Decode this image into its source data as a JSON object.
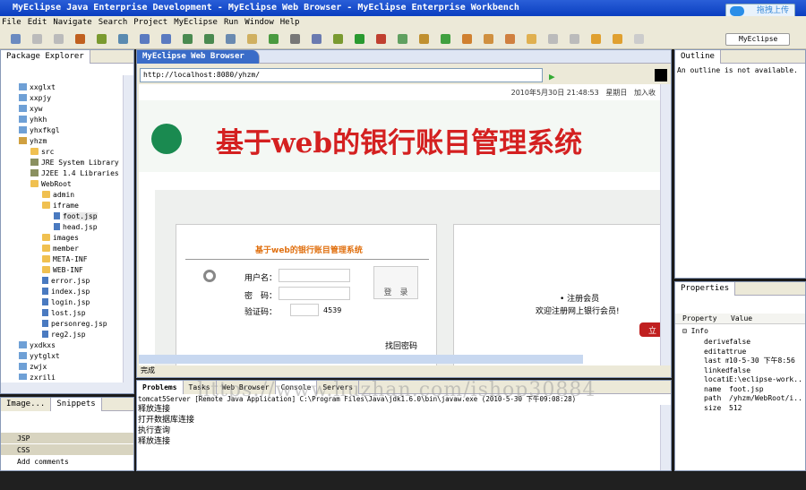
{
  "window": {
    "title": "MyEclipse Java Enterprise Development - MyEclipse Web Browser - MyEclipse Enterprise Workbench",
    "upload_label": "拖拽上传"
  },
  "menu": [
    "File",
    "Edit",
    "Navigate",
    "Search",
    "Project",
    "MyEclipse",
    "Run",
    "Window",
    "Help"
  ],
  "perspective": "MyEclipse ...",
  "package_explorer": {
    "title": "Package Explorer",
    "tree": [
      {
        "label": "xxglxt",
        "depth": 0,
        "type": "fold"
      },
      {
        "label": "xxpjy",
        "depth": 0,
        "type": "fold"
      },
      {
        "label": "xyw",
        "depth": 0,
        "type": "fold"
      },
      {
        "label": "yhkh",
        "depth": 0,
        "type": "fold"
      },
      {
        "label": "yhxfkgl",
        "depth": 0,
        "type": "fold"
      },
      {
        "label": "yhzm",
        "depth": 0,
        "type": "proj"
      },
      {
        "label": "src",
        "depth": 1,
        "type": "ofold"
      },
      {
        "label": "JRE System Library [W",
        "depth": 1,
        "type": "lib"
      },
      {
        "label": "J2EE 1.4 Libraries",
        "depth": 1,
        "type": "lib"
      },
      {
        "label": "WebRoot",
        "depth": 1,
        "type": "ofold"
      },
      {
        "label": "admin",
        "depth": 2,
        "type": "ofold"
      },
      {
        "label": "iframe",
        "depth": 2,
        "type": "ofold"
      },
      {
        "label": "foot.jsp",
        "depth": 3,
        "type": "jsp"
      },
      {
        "label": "head.jsp",
        "depth": 3,
        "type": "jsp"
      },
      {
        "label": "images",
        "depth": 2,
        "type": "ofold"
      },
      {
        "label": "member",
        "depth": 2,
        "type": "ofold"
      },
      {
        "label": "META-INF",
        "depth": 2,
        "type": "ofold"
      },
      {
        "label": "WEB-INF",
        "depth": 2,
        "type": "ofold"
      },
      {
        "label": "error.jsp",
        "depth": 2,
        "type": "jsp"
      },
      {
        "label": "index.jsp",
        "depth": 2,
        "type": "jsp"
      },
      {
        "label": "login.jsp",
        "depth": 2,
        "type": "jsp"
      },
      {
        "label": "lost.jsp",
        "depth": 2,
        "type": "jsp"
      },
      {
        "label": "personreg.jsp",
        "depth": 2,
        "type": "jsp"
      },
      {
        "label": "reg2.jsp",
        "depth": 2,
        "type": "jsp"
      },
      {
        "label": "yxdkxs",
        "depth": 0,
        "type": "fold"
      },
      {
        "label": "yytglxt",
        "depth": 0,
        "type": "fold"
      },
      {
        "label": "zwjx",
        "depth": 0,
        "type": "fold"
      },
      {
        "label": "zxrili",
        "depth": 0,
        "type": "fold"
      }
    ]
  },
  "snippets": {
    "tab_image": "Image...",
    "tab_snippets": "Snippets",
    "items": [
      "JSP",
      "CSS",
      "Add comments"
    ]
  },
  "browser": {
    "tab": "MyEclipse Web Browser",
    "url": "http://localhost:8080/yhzm/",
    "status": "完成",
    "page": {
      "date": "2010年5月30日 21:48:53",
      "weekday": "星期日",
      "favorite": "加入收",
      "banner": "基于web的银行账目管理系统",
      "login_title": "基于web的银行账目管理系统",
      "username_label": "用户名：",
      "password_label": "密　码：",
      "captcha_label": "验证码：",
      "captcha_code": "4539",
      "login_button": "登　录",
      "forgot": "找回密码",
      "register_title": "• 注册会员",
      "register_text": "欢迎注册网上银行会员!",
      "register_btn": "立"
    }
  },
  "outline": {
    "title": "Outline",
    "message": "An outline is not available."
  },
  "properties": {
    "title": "Properties",
    "col_property": "Property",
    "col_value": "Value",
    "group": "Info",
    "rows": [
      {
        "k": "derive",
        "v": "false"
      },
      {
        "k": "editat",
        "v": "true"
      },
      {
        "k": "last m",
        "v": "10-5-30 下午8:56"
      },
      {
        "k": "linked",
        "v": "false"
      },
      {
        "k": "locati",
        "v": "E:\\eclipse-work..."
      },
      {
        "k": "name",
        "v": "foot.jsp"
      },
      {
        "k": "path",
        "v": "/yhzm/WebRoot/i..."
      },
      {
        "k": "size",
        "v": "512"
      }
    ]
  },
  "console": {
    "tabs": [
      "Problems",
      "Tasks",
      "Web Browser",
      "Console",
      "Servers"
    ],
    "header": "tomcat5Server [Remote Java Application] C:\\Program Files\\Java\\jdk1.6.0\\bin\\javaw.exe (2010-5-30 下午09:08:28)",
    "lines": [
      "释放连接",
      "打开数据库连接",
      "执行查询",
      "释放连接"
    ]
  },
  "watermark": "https://www.huzhan.com/ishop30884"
}
